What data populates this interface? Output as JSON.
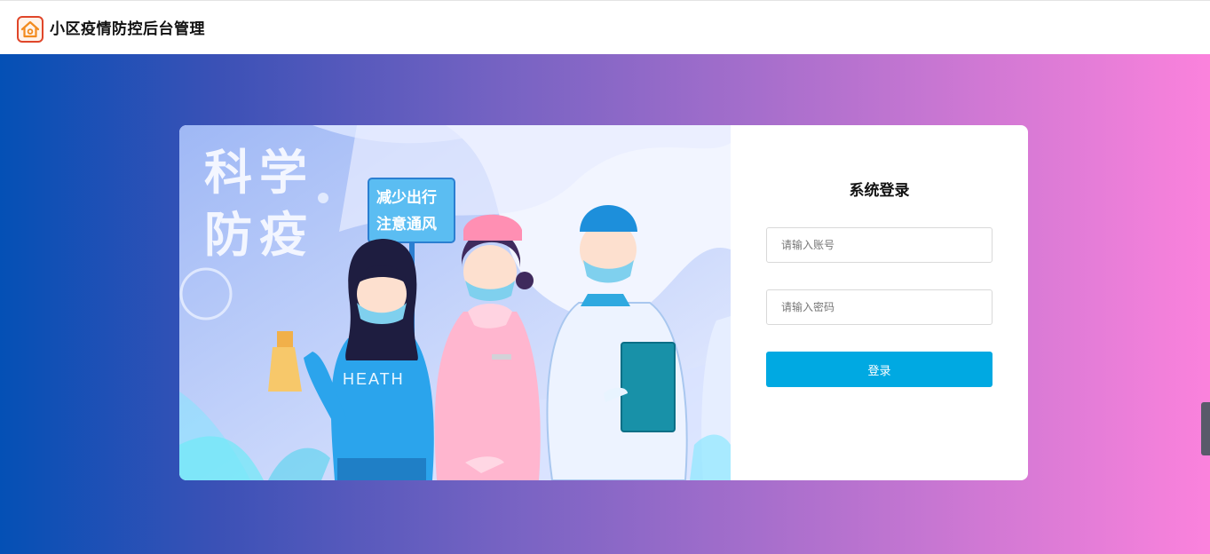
{
  "header": {
    "title": "小区疫情防控后台管理",
    "logo_icon": "house-icon"
  },
  "illustration": {
    "headline_line1": "科学",
    "headline_line2": "防疫",
    "sign_line1": "减少出行",
    "sign_line2": "注意通风",
    "shirt_text": "HEATH"
  },
  "login": {
    "title": "系统登录",
    "account_placeholder": "请输入账号",
    "password_placeholder": "请输入密码",
    "submit_label": "登录"
  },
  "colors": {
    "accent": "#00a9e2",
    "gradient_start": "#0450b5",
    "gradient_end": "#fb82dc"
  }
}
